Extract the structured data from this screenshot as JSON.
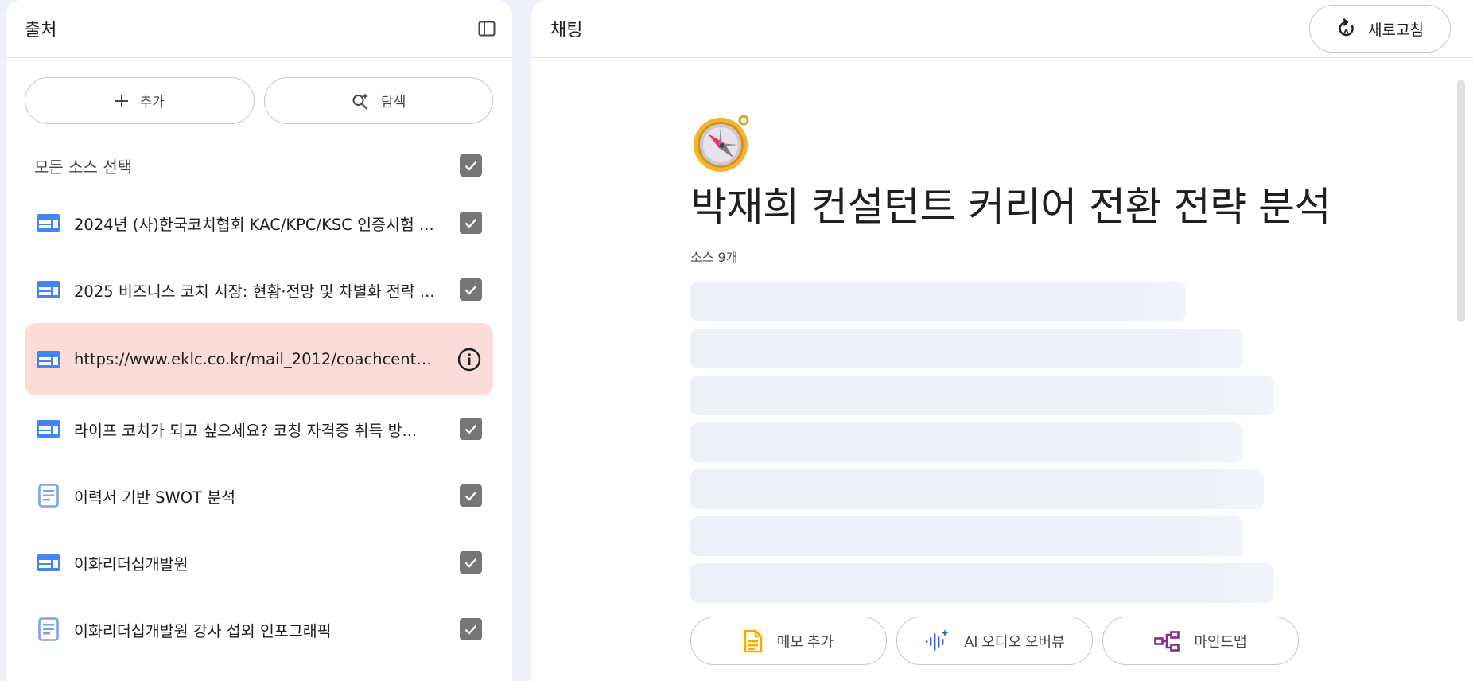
{
  "sources": {
    "title": "출처",
    "add_label": "추가",
    "discover_label": "탐색",
    "select_all_label": "모든 소스 선택",
    "items": [
      {
        "title": "2024년 (사)한국코치협회 KAC/KPC/KSC 인증시험 ...",
        "icon": "web-icon",
        "status": "checked"
      },
      {
        "title": "2025 비즈니스 코치 시장: 현황·전망 및 차별화 전략 ...",
        "icon": "web-icon",
        "status": "checked"
      },
      {
        "title": "https://www.eklc.co.kr/mail_2012/coachcenter/p...",
        "icon": "web-icon",
        "status": "error"
      },
      {
        "title": "라이프 코치가 되고 싶으세요? 코칭 자격증 취득 방...",
        "icon": "web-icon",
        "status": "checked"
      },
      {
        "title": "이력서 기반 SWOT 분석",
        "icon": "document-icon",
        "status": "checked"
      },
      {
        "title": "이화리더십개발원",
        "icon": "web-icon",
        "status": "checked"
      },
      {
        "title": "이화리더십개발원 강사 섭외 인포그래픽",
        "icon": "document-icon",
        "status": "checked"
      }
    ]
  },
  "chat": {
    "title": "채팅",
    "refresh_label": "새로고침",
    "notebook_title": "박재희 컨설턴트 커리어 전환 전략 분석",
    "source_count": "소스 9개",
    "notebook_icon": "compass-icon",
    "actions": {
      "memo_label": "메모 추가",
      "audio_label": "AI 오디오 오버뷰",
      "mindmap_label": "마인드맵"
    }
  },
  "colors": {
    "background": "#eef0fa",
    "error_row": "#fbdcd8",
    "checkbox": "#747775",
    "web_icon": "#4285f4",
    "doc_icon": "#7ea2ee",
    "memo_icon": "#f9ab00",
    "audio_icon": "#3d5fd6",
    "mindmap_icon": "#8b2a83",
    "skeleton": "#edf1f7"
  }
}
